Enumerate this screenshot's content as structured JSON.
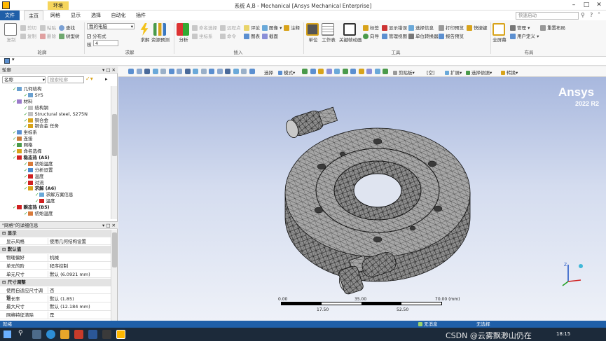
{
  "window": {
    "title": "系统 A,B - Mechanical [Ansys Mechanical Enterprise]",
    "context_tab": "环境"
  },
  "tabs": [
    "文件",
    "主页",
    "网格",
    "显示",
    "选择",
    "自动化",
    "插件"
  ],
  "quick_search": {
    "placeholder": "快速启动"
  },
  "ribbon": {
    "groups": [
      "轮廓",
      "求解",
      "插入",
      "工具",
      "布局"
    ],
    "outline_group": {
      "duplicate": "复制",
      "copy": "复制",
      "cut": "剪切",
      "paste": "粘贴",
      "delete": "删除",
      "find": "查找",
      "tree": "树型树"
    },
    "solve_group": {
      "computer": "我的电脑",
      "distributed": "分布式",
      "cores_label": "核",
      "cores_value": "4",
      "solve": "求解",
      "resource": "资源预测"
    },
    "insert_group": {
      "analysis": "分析",
      "named_sel": "命名选择",
      "coord": "坐标系",
      "remote": "远程点",
      "command": "命令",
      "comment": "评论",
      "image": "图像",
      "annotation": "注释",
      "chart": "图表",
      "section": "截面"
    },
    "tools_group": {
      "units": "单位",
      "worksheet": "工作表",
      "keyframe": "关键帧动画",
      "tags": "标签",
      "wizard": "向导",
      "show_errors": "显示错误",
      "manage": "管理视图",
      "selection_info": "选择信息",
      "unit_converter": "单位转换器",
      "print_preview": "打印预览",
      "report_preview": "报告预览",
      "shortcuts": "快捷键"
    },
    "layout_group": {
      "full_screen": "全屏幕",
      "manage": "管理",
      "user_defined": "用户定义",
      "reset": "重置布局"
    }
  },
  "outline": {
    "header": "轮廓",
    "name_label": "名称",
    "search_placeholder": "搜索轮廓",
    "tree": [
      {
        "label": "几何结构",
        "bold": false
      },
      {
        "label": "SYS",
        "bold": false
      },
      {
        "label": "材料",
        "bold": false
      },
      {
        "label": "结构钢",
        "bold": false
      },
      {
        "label": "Structural steel, S275N",
        "bold": false
      },
      {
        "label": "铜合金",
        "bold": false
      },
      {
        "label": "铜合金 任务",
        "bold": false
      },
      {
        "label": "坐标系",
        "bold": false
      },
      {
        "label": "连接",
        "bold": false
      },
      {
        "label": "网格",
        "bold": false
      },
      {
        "label": "命名选择",
        "bold": false
      },
      {
        "label": "稳态热 (A5)",
        "bold": true
      },
      {
        "label": "初始温度",
        "bold": false
      },
      {
        "label": "分析设置",
        "bold": false
      },
      {
        "label": "温度",
        "bold": false
      },
      {
        "label": "对流",
        "bold": false
      },
      {
        "label": "求解 (A6)",
        "bold": true
      },
      {
        "label": "求解方案信息",
        "bold": false
      },
      {
        "label": "温度",
        "bold": false
      },
      {
        "label": "瞬态热 (B5)",
        "bold": true
      },
      {
        "label": "初始温度",
        "bold": false
      }
    ]
  },
  "details": {
    "header": "\"网格\"的详细信息",
    "rows": [
      {
        "type": "section",
        "key": "显示"
      },
      {
        "type": "row",
        "key": "显示风格",
        "value": "使用几何结构设置"
      },
      {
        "type": "section",
        "key": "默认值"
      },
      {
        "type": "row",
        "key": "物理偏好",
        "value": "机械"
      },
      {
        "type": "row",
        "key": "单元的阶",
        "value": "程序控制"
      },
      {
        "type": "row",
        "key": "单元尺寸",
        "value": "默认 (6.0921 mm)"
      },
      {
        "type": "section",
        "key": "尺寸调整"
      },
      {
        "type": "row",
        "key": "使用自适应尺寸调整",
        "value": "否"
      },
      {
        "type": "row",
        "key": "增长率",
        "value": "默认 (1.85)"
      },
      {
        "type": "row",
        "key": "最大尺寸",
        "value": "默认 (12.184 mm)"
      },
      {
        "type": "row",
        "key": "网格特征清除",
        "value": "是"
      }
    ]
  },
  "viewport": {
    "brand": "Ansys",
    "version": "2022 R2",
    "toolbar": {
      "select": "选择",
      "mode": "模式",
      "clipboard": "剪贴板",
      "empty": "[空]",
      "expand": "扩展",
      "select_by": "选择依据",
      "convert": "转换"
    },
    "scale": {
      "ticks_top": [
        "0.00",
        "35.00",
        "70.00 (mm)"
      ],
      "ticks_bottom": [
        "17.50",
        "52.50"
      ]
    }
  },
  "statusbar": {
    "ready": "就绪",
    "messages": "无消息",
    "selection": "无选择"
  },
  "taskbar": {
    "time": "18:15",
    "watermark": "CSDN @云雾飘渺山仍在"
  },
  "colors": {
    "file_tab": "#1f5fa8",
    "status_bar": "#1f5fa8",
    "context_tab": "#f6d55c",
    "viewport_top": "#a8b8de",
    "viewport_bottom": "#eef1f8"
  }
}
